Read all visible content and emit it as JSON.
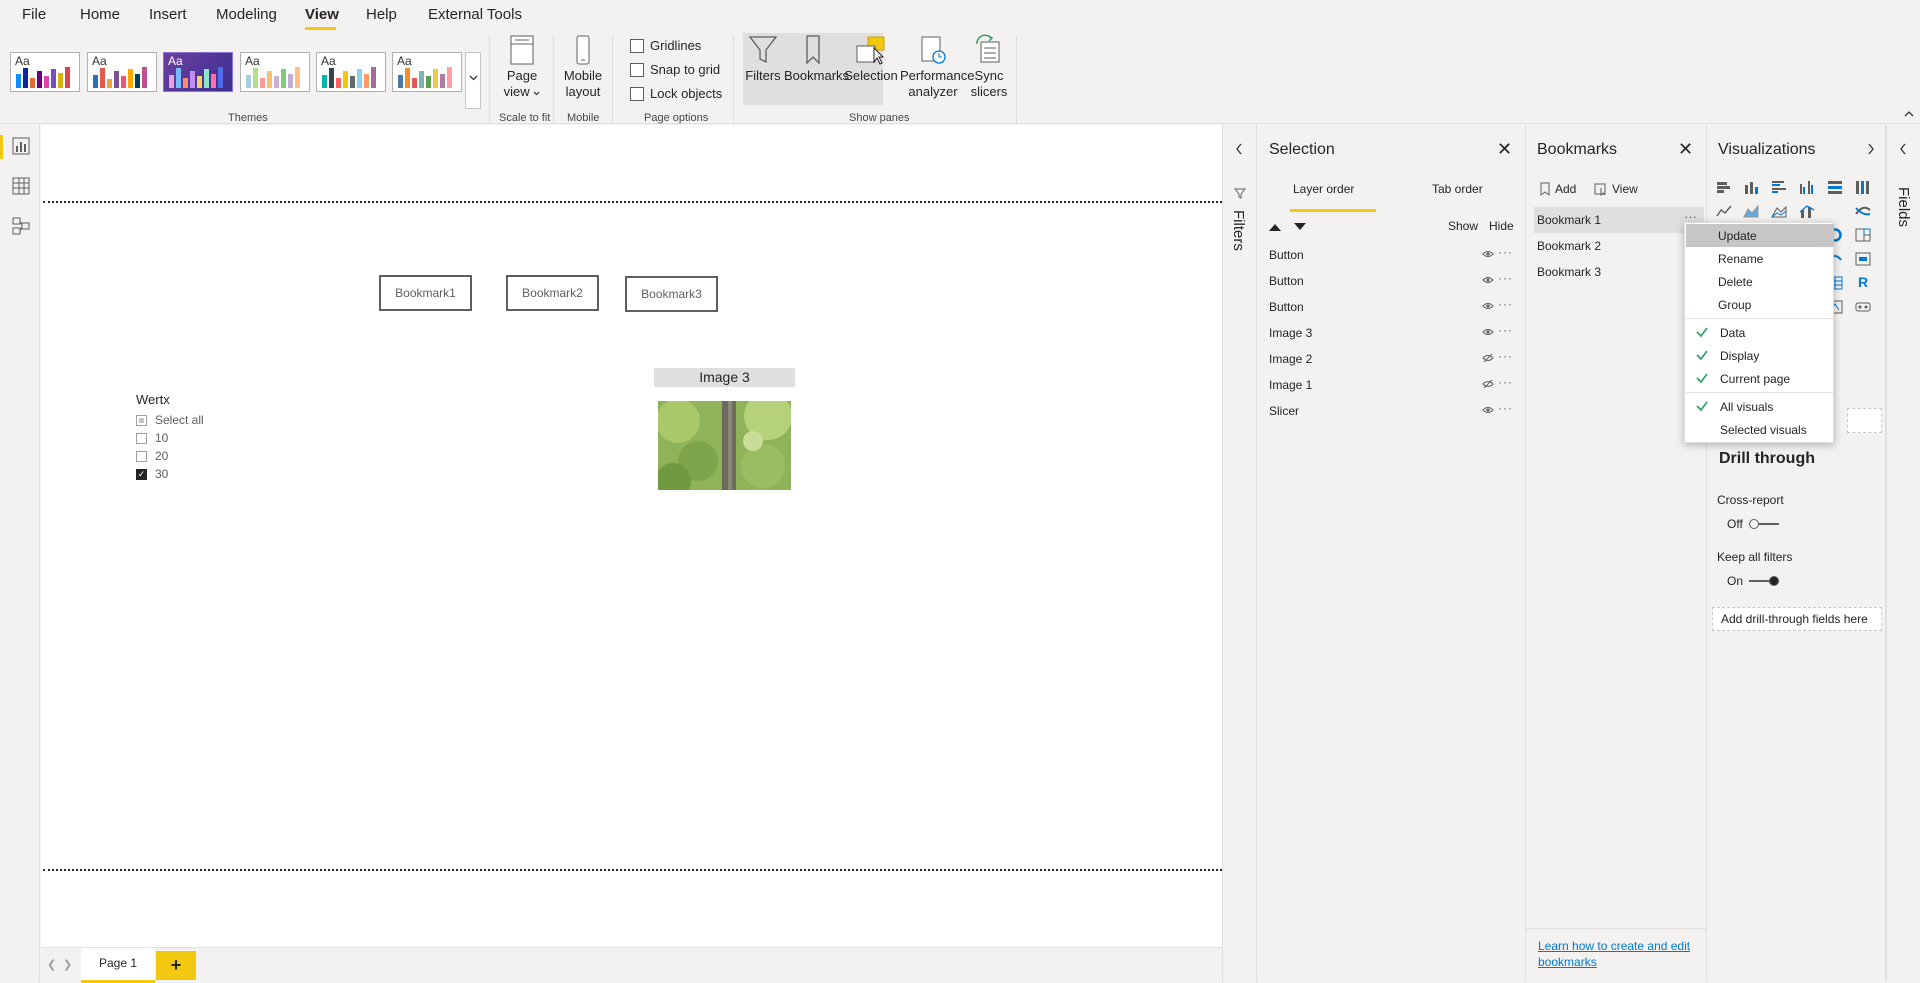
{
  "menu": {
    "items": [
      "File",
      "Home",
      "Insert",
      "Modeling",
      "View",
      "Help",
      "External Tools"
    ],
    "active": "View"
  },
  "ribbon": {
    "themes_label": "Themes",
    "theme_preview_text": "Aa",
    "scale_label": "Scale to fit",
    "mobile_label": "Mobile",
    "page_options_label": "Page options",
    "show_panes_label": "Show panes",
    "page_view": {
      "line1": "Page",
      "line2": "view"
    },
    "mobile_layout": {
      "line1": "Mobile",
      "line2": "layout"
    },
    "checkboxes": [
      "Gridlines",
      "Snap to grid",
      "Lock objects"
    ],
    "panes": {
      "filters": "Filters",
      "bookmarks": "Bookmarks",
      "selection": "Selection",
      "perf_line1": "Performance",
      "perf_line2": "analyzer",
      "sync_line1": "Sync",
      "sync_line2": "slicers"
    }
  },
  "canvas": {
    "buttons": [
      "Bookmark1",
      "Bookmark2",
      "Bookmark3"
    ],
    "slicer": {
      "title": "Wertx",
      "items": [
        {
          "label": "Select all",
          "state": "partial"
        },
        {
          "label": "10",
          "state": "unchecked"
        },
        {
          "label": "20",
          "state": "unchecked"
        },
        {
          "label": "30",
          "state": "checked"
        }
      ]
    },
    "image_title": "Image 3"
  },
  "pagebar": {
    "page": "Page 1",
    "add": "+"
  },
  "filters_pane": {
    "label": "Filters"
  },
  "selection_pane": {
    "title": "Selection",
    "tabs": [
      "Layer order",
      "Tab order"
    ],
    "show_label": "Show",
    "hide_label": "Hide",
    "layers": [
      {
        "name": "Button",
        "visible": true
      },
      {
        "name": "Button",
        "visible": true
      },
      {
        "name": "Button",
        "visible": true
      },
      {
        "name": "Image 3",
        "visible": true
      },
      {
        "name": "Image 2",
        "visible": false
      },
      {
        "name": "Image 1",
        "visible": false
      },
      {
        "name": "Slicer",
        "visible": true
      }
    ]
  },
  "bookmarks_pane": {
    "title": "Bookmarks",
    "add": "Add",
    "view": "View",
    "items": [
      "Bookmark 1",
      "Bookmark 2",
      "Bookmark 3"
    ],
    "learn_link": "Learn how to create and edit bookmarks"
  },
  "context_menu": {
    "items": [
      "Update",
      "Rename",
      "Delete",
      "Group"
    ],
    "checked_items": [
      "Data",
      "Display",
      "Current page"
    ],
    "scope_items": [
      {
        "label": "All visuals",
        "checked": true
      },
      {
        "label": "Selected visuals",
        "checked": false
      }
    ]
  },
  "visualizations_pane": {
    "title": "Visualizations",
    "drill_through": "Drill through",
    "cross_report": "Cross-report",
    "cross_report_state": "Off",
    "keep_filters": "Keep all filters",
    "keep_filters_state": "On",
    "add_fields": "Add drill-through fields here"
  },
  "fields_pane": {
    "label": "Fields"
  },
  "colors": {
    "accent": "#f2c811",
    "check": "#3a9f6c",
    "link": "#0078d4"
  }
}
